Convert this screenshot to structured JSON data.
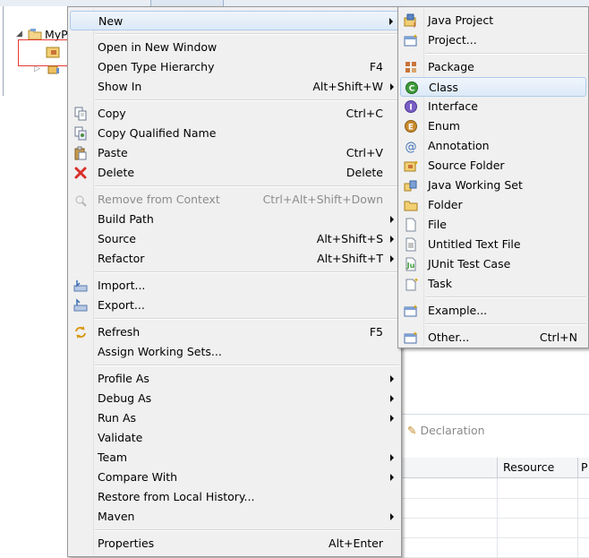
{
  "project_tree": {
    "item_label": "MyP"
  },
  "bottom_panel": {
    "tab_declaration": "Declaration",
    "columns": [
      "",
      "Resource",
      "P"
    ],
    "row_count": 4
  },
  "main_menu": {
    "items": [
      {
        "label": "New",
        "accel": "",
        "submenu": true,
        "icon": "none",
        "disabled": false,
        "highlighted": true
      },
      {
        "sep": true
      },
      {
        "label": "Open in New Window",
        "accel": "",
        "submenu": false,
        "icon": "none",
        "disabled": false
      },
      {
        "label": "Open Type Hierarchy",
        "accel": "F4",
        "submenu": false,
        "icon": "none",
        "disabled": false
      },
      {
        "label": "Show In",
        "accel": "Alt+Shift+W",
        "submenu": true,
        "icon": "none",
        "disabled": false
      },
      {
        "sep": true
      },
      {
        "label": "Copy",
        "accel": "Ctrl+C",
        "submenu": false,
        "icon": "copy-icon",
        "disabled": false
      },
      {
        "label": "Copy Qualified Name",
        "accel": "",
        "submenu": false,
        "icon": "copy-qualified-name-icon",
        "disabled": false
      },
      {
        "label": "Paste",
        "accel": "Ctrl+V",
        "submenu": false,
        "icon": "paste-icon",
        "disabled": false
      },
      {
        "label": "Delete",
        "accel": "Delete",
        "submenu": false,
        "icon": "delete-icon",
        "disabled": false
      },
      {
        "sep": true
      },
      {
        "label": "Remove from Context",
        "accel": "Ctrl+Alt+Shift+Down",
        "submenu": false,
        "icon": "remove-context-icon",
        "disabled": true
      },
      {
        "label": "Build Path",
        "accel": "",
        "submenu": true,
        "icon": "none",
        "disabled": false
      },
      {
        "label": "Source",
        "accel": "Alt+Shift+S",
        "submenu": true,
        "icon": "none",
        "disabled": false
      },
      {
        "label": "Refactor",
        "accel": "Alt+Shift+T",
        "submenu": true,
        "icon": "none",
        "disabled": false
      },
      {
        "sep": true
      },
      {
        "label": "Import...",
        "accel": "",
        "submenu": false,
        "icon": "import-icon",
        "disabled": false
      },
      {
        "label": "Export...",
        "accel": "",
        "submenu": false,
        "icon": "export-icon",
        "disabled": false
      },
      {
        "sep": true
      },
      {
        "label": "Refresh",
        "accel": "F5",
        "submenu": false,
        "icon": "refresh-icon",
        "disabled": false
      },
      {
        "label": "Assign Working Sets...",
        "accel": "",
        "submenu": false,
        "icon": "none",
        "disabled": false
      },
      {
        "sep": true
      },
      {
        "label": "Profile As",
        "accel": "",
        "submenu": true,
        "icon": "none",
        "disabled": false
      },
      {
        "label": "Debug As",
        "accel": "",
        "submenu": true,
        "icon": "none",
        "disabled": false
      },
      {
        "label": "Run As",
        "accel": "",
        "submenu": true,
        "icon": "none",
        "disabled": false
      },
      {
        "label": "Validate",
        "accel": "",
        "submenu": false,
        "icon": "none",
        "disabled": false
      },
      {
        "label": "Team",
        "accel": "",
        "submenu": true,
        "icon": "none",
        "disabled": false
      },
      {
        "label": "Compare With",
        "accel": "",
        "submenu": true,
        "icon": "none",
        "disabled": false
      },
      {
        "label": "Restore from Local History...",
        "accel": "",
        "submenu": false,
        "icon": "none",
        "disabled": false
      },
      {
        "label": "Maven",
        "accel": "",
        "submenu": true,
        "icon": "none",
        "disabled": false
      },
      {
        "sep": true
      },
      {
        "label": "Properties",
        "accel": "Alt+Enter",
        "submenu": false,
        "icon": "none",
        "disabled": false
      }
    ]
  },
  "new_menu": {
    "items": [
      {
        "label": "Java Project",
        "accel": "",
        "icon": "java-project-icon"
      },
      {
        "label": "Project...",
        "accel": "",
        "icon": "project-icon"
      },
      {
        "sep": true
      },
      {
        "label": "Package",
        "accel": "",
        "icon": "package-icon"
      },
      {
        "label": "Class",
        "accel": "",
        "icon": "class-icon",
        "highlighted": true
      },
      {
        "label": "Interface",
        "accel": "",
        "icon": "interface-icon"
      },
      {
        "label": "Enum",
        "accel": "",
        "icon": "enum-icon"
      },
      {
        "label": "Annotation",
        "accel": "",
        "icon": "annotation-icon"
      },
      {
        "label": "Source Folder",
        "accel": "",
        "icon": "source-folder-icon"
      },
      {
        "label": "Java Working Set",
        "accel": "",
        "icon": "java-working-set-icon"
      },
      {
        "label": "Folder",
        "accel": "",
        "icon": "folder-icon"
      },
      {
        "label": "File",
        "accel": "",
        "icon": "file-icon"
      },
      {
        "label": "Untitled Text File",
        "accel": "",
        "icon": "untitled-text-file-icon"
      },
      {
        "label": "JUnit Test Case",
        "accel": "",
        "icon": "junit-test-case-icon"
      },
      {
        "label": "Task",
        "accel": "",
        "icon": "task-icon"
      },
      {
        "sep": true
      },
      {
        "label": "Example...",
        "accel": "",
        "icon": "example-icon"
      },
      {
        "sep": true
      },
      {
        "label": "Other...",
        "accel": "Ctrl+N",
        "icon": "other-icon"
      }
    ]
  },
  "colors": {
    "menu_bg": "#f0f0f0",
    "highlight_bg": "#dce9f7",
    "highlight_border": "#aecbec",
    "disabled_text": "#8c8c8c",
    "selection_box": "#e53935"
  }
}
